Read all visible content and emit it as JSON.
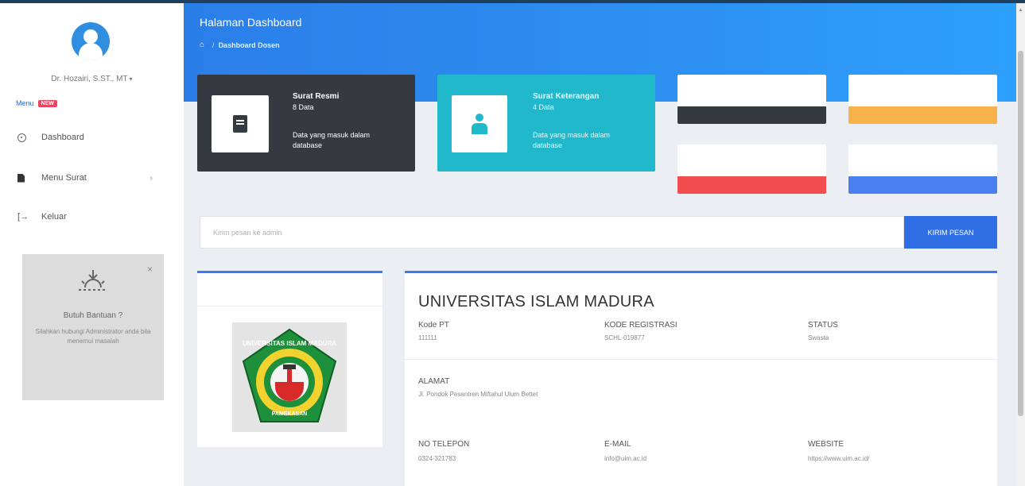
{
  "sidebar": {
    "user_name": "Dr. Hozairi, S.ST., MT",
    "menu_label": "Menu",
    "menu_badge": "NEW",
    "nav_items": [
      {
        "label": "Dashboard",
        "icon": "dashboard-icon"
      },
      {
        "label": "Menu Surat",
        "icon": "file-icon",
        "chevron": "›"
      },
      {
        "label": "Keluar",
        "icon": "logout-icon"
      }
    ],
    "help": {
      "title": "Butuh Bantuan ?",
      "text": "Silahkan hubungi Administrator anda bila menemui masalah",
      "close": "×"
    }
  },
  "header": {
    "page_title": "Halaman Dashboard",
    "breadcrumb_current": "Dashboard Dosen"
  },
  "stats": [
    {
      "title": "Surat Resmi",
      "count": "8 Data",
      "description": "Data yang masuk dalam database",
      "color": "#343a40"
    },
    {
      "title": "Surat Keterangan",
      "count": "4 Data",
      "description": "Data yang masuk dalam database",
      "color": "#21b8cc"
    }
  ],
  "mini_cards": [
    {
      "color": "#343a40"
    },
    {
      "color": "#f7b24a"
    },
    {
      "color": "#f24e4e"
    },
    {
      "color": "#4a7ff2"
    }
  ],
  "message": {
    "placeholder": "Kirim pesan ke admin",
    "button_label": "KIRIM PESAN"
  },
  "university": {
    "name": "UNIVERSITAS ISLAM MADURA",
    "fields": [
      {
        "label": "Kode PT",
        "value": "111111"
      },
      {
        "label": "KODE REGISTRASI",
        "value": "SCHL-019877"
      },
      {
        "label": "STATUS",
        "value": "Swasta"
      },
      {
        "label": "ALAMAT",
        "value": "Jl. Pondok Pesantren Miftahul Ulum Bettet"
      },
      {
        "label": "NO TELEPON",
        "value": "0324-321783"
      },
      {
        "label": "E-MAIL",
        "value": "info@uim.ac.id"
      },
      {
        "label": "WEBSITE",
        "value": "https://www.uim.ac.id/"
      }
    ],
    "logo_text_top": "UNIVERSITAS ISLAM MADURA",
    "logo_text_bottom": "PAMEKASAN"
  },
  "colors": {
    "accent": "#2f6ee5",
    "banner": "#2d8df0"
  }
}
